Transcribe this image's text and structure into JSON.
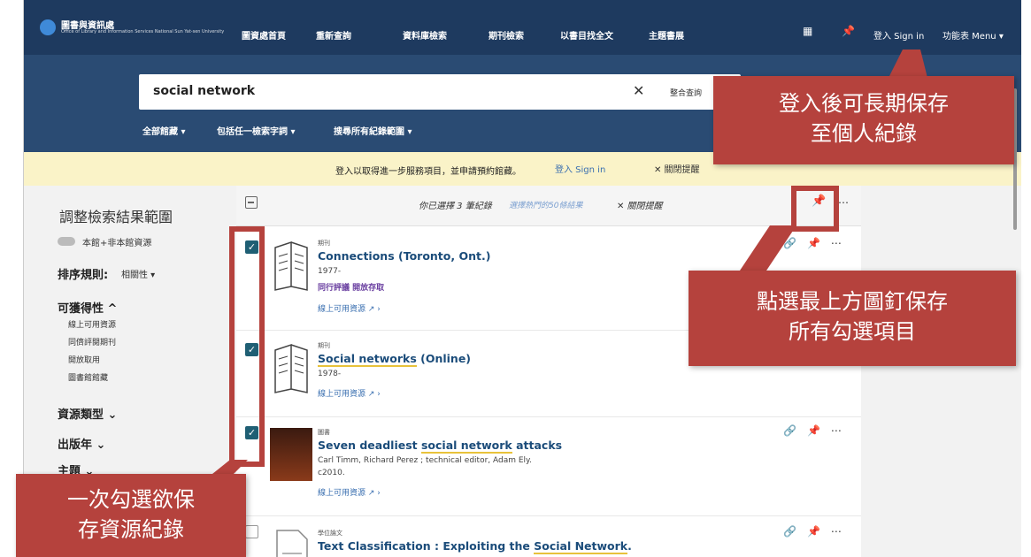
{
  "header": {
    "logo_title": "圖書與資訊處",
    "logo_subtitle": "Office of Library and Information Services National Sun Yat-sen University",
    "nav": [
      "圖資處首頁",
      "重新查詢",
      "資料庫檢索",
      "期刊檢索",
      "以書目找全文",
      "主題書展"
    ],
    "signin": "登入 Sign in",
    "menu": "功能表 Menu ▾"
  },
  "search": {
    "query": "social network",
    "clear": "✕",
    "combo": "整合查詢",
    "filters": [
      "全部館藏 ▾",
      "包括任一檢索字詞 ▾",
      "搜尋所有紀錄範圍 ▾"
    ]
  },
  "notice": {
    "text": "登入以取得進一步服務項目，並申請預約館藏。",
    "signin": "登入 Sign in",
    "close": "✕ 關閉提醒"
  },
  "sidebar": {
    "title": "調整檢索結果範圍",
    "toggle_label": "本館+非本館資源",
    "sort_label": "排序規則:",
    "sort_value": "相關性 ▾",
    "availability": "可獲得性 ^",
    "availability_items": [
      "線上可用資源",
      "同儕評閱期刊",
      "開放取用",
      "圖書館館藏"
    ],
    "resource_type": "資源類型 ⌄",
    "pub_year": "出版年 ⌄",
    "subject": "主題 ⌄"
  },
  "selection": {
    "text": "你已選擇 3 筆紀錄",
    "popular": "選擇熱門的50條結果",
    "close": "✕ 關閉提醒"
  },
  "records": [
    {
      "checked": true,
      "type": "期刊",
      "title_pre": "Connections (Toronto, Ont.)",
      "title_hl": "",
      "title_post": "",
      "lines": [
        "1977-"
      ],
      "badges": "同行評議  開放存取",
      "link": "線上可用資源 ↗ ›",
      "icon": "journal"
    },
    {
      "checked": true,
      "type": "期刊",
      "title_pre": "",
      "title_hl": "Social networks",
      "title_post": " (Online)",
      "lines": [
        "1978-"
      ],
      "badges": "",
      "link": "線上可用資源 ↗ ›",
      "icon": "journal"
    },
    {
      "checked": true,
      "type": "圖書",
      "title_pre": "Seven deadliest ",
      "title_hl": "social network",
      "title_post": " attacks",
      "lines": [
        "Carl Timm, Richard Perez ; technical editor, Adam Ely.",
        "c2010."
      ],
      "badges": "",
      "link": "線上可用資源 ↗ ›",
      "icon": "book"
    },
    {
      "checked": false,
      "type": "學位論文",
      "title_pre": "Text Classification : Exploiting the ",
      "title_hl": "Social Network",
      "title_post": ".",
      "lines": [],
      "badges": "",
      "link": "",
      "icon": "doc"
    }
  ],
  "callouts": {
    "top_right": "登入後可長期保存\n至個人紀錄",
    "middle_right": "點選最上方圖釘保存\n所有勾選項目",
    "bottom_left": "一次勾選欲保\n存資源紀錄"
  },
  "colors": {
    "header": "#1e3a5f",
    "search_band": "#2a4b73",
    "notice": "#faf3c8",
    "callout": "#b5423d",
    "checkbox": "#1f5f74",
    "link": "#3a6fb0"
  }
}
